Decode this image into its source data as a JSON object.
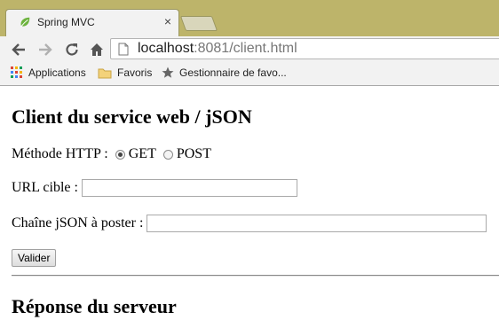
{
  "browser": {
    "tab_title": "Spring MVC",
    "tab_close": "×",
    "url_host": "localhost",
    "url_path": ":8081/client.html",
    "bookmarks": {
      "apps": "Applications",
      "favoris": "Favoris",
      "manager": "Gestionnaire de favo..."
    }
  },
  "page": {
    "title": "Client du service web / jSON",
    "method_label": "Méthode HTTP :",
    "method_options": [
      "GET",
      "POST"
    ],
    "method_selected": "GET",
    "url_label": "URL cible :",
    "url_value": "",
    "json_label": "Chaîne jSON à poster :",
    "json_value": "",
    "submit_label": "Valider",
    "response_title": "Réponse du serveur"
  },
  "colors": {
    "chrome": "#bdb46a",
    "toolbar": "#f2f2f2",
    "spring_green": "#6db33f"
  }
}
